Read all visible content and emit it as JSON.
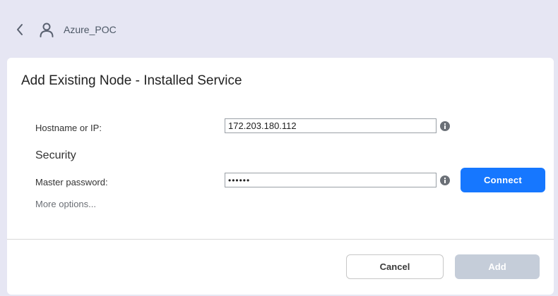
{
  "header": {
    "back_icon": "chevron-left-icon",
    "user_icon": "user-icon",
    "breadcrumb": "Azure_POC"
  },
  "dialog": {
    "title": "Add Existing Node - Installed Service",
    "hostname": {
      "label": "Hostname or IP:",
      "value": "172.203.180.112",
      "info_icon": "info-icon"
    },
    "security_heading": "Security",
    "password": {
      "label": "Master password:",
      "value": "123456",
      "info_icon": "info-icon"
    },
    "connect_label": "Connect",
    "more_options": "More options...",
    "cancel_label": "Cancel",
    "add_label": "Add"
  },
  "colors": {
    "background": "#e6e6f3",
    "primary": "#1677ff",
    "disabled": "#c5cdd9",
    "info_icon": "#6b7077"
  }
}
